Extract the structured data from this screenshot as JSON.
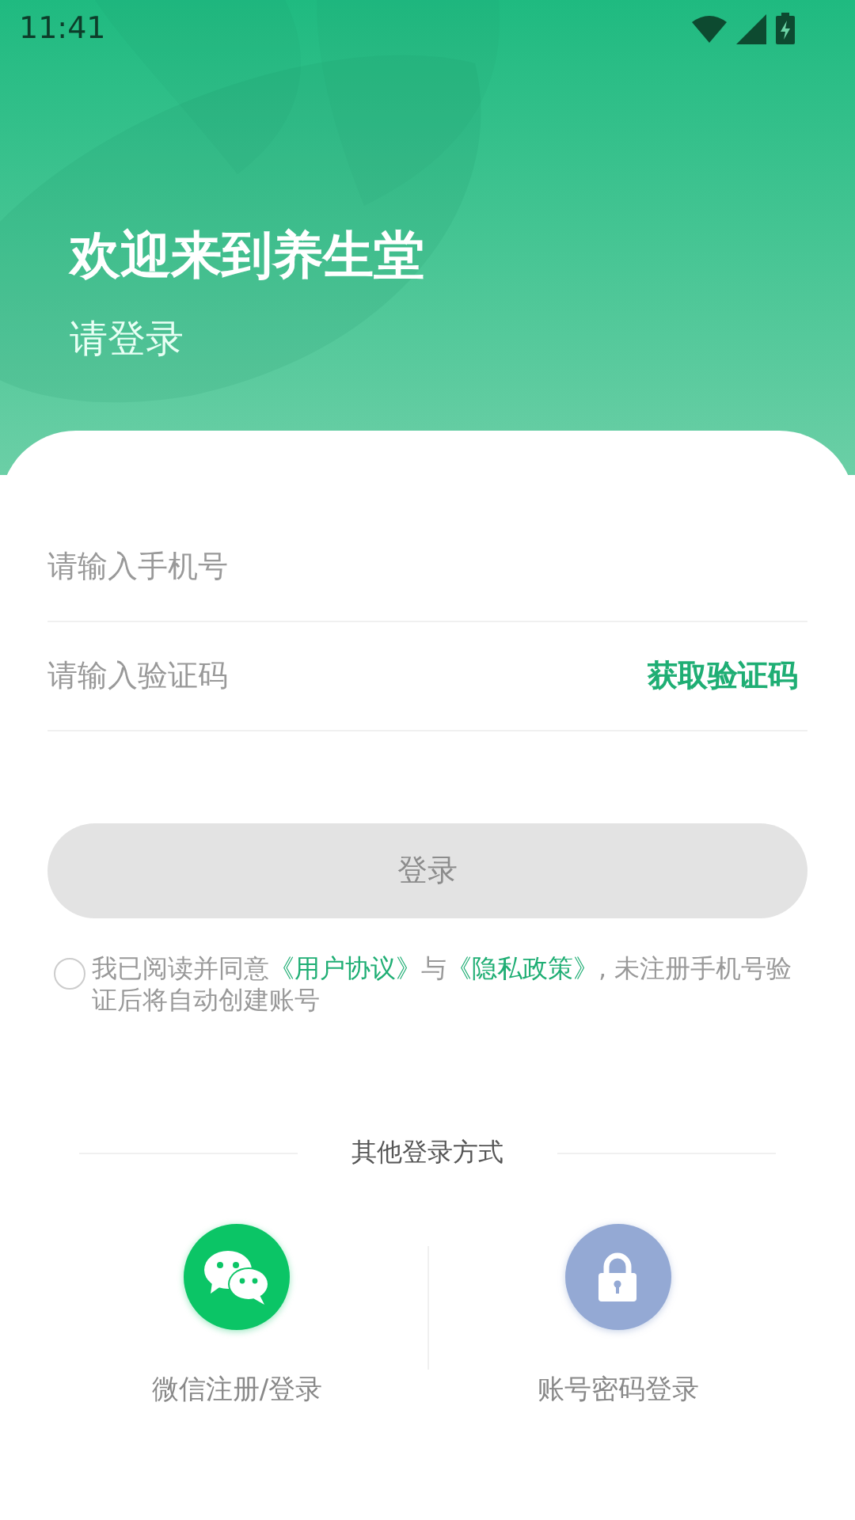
{
  "status_bar": {
    "time": "11:41"
  },
  "header": {
    "title": "欢迎来到养生堂",
    "subtitle": "请登录"
  },
  "form": {
    "phone": {
      "placeholder": "请输入手机号"
    },
    "code": {
      "placeholder": "请输入验证码",
      "action": "获取验证码"
    },
    "login_button": {
      "label": "登录",
      "disabled": true
    }
  },
  "agreement": {
    "checked": false,
    "parts": [
      {
        "kind": "plain",
        "text": "我已阅读并同意"
      },
      {
        "kind": "link",
        "text": "《用户协议》"
      },
      {
        "kind": "plain",
        "text": "与"
      },
      {
        "kind": "link",
        "text": "《隐私政策》"
      },
      {
        "kind": "plain",
        "text": ", 未注册手机号验证后将自动创建账号"
      }
    ]
  },
  "other_login": {
    "title": "其他登录方式",
    "options": [
      {
        "kind": "wechat",
        "label": "微信注册/登录"
      },
      {
        "kind": "password",
        "label": "账号密码登录"
      }
    ]
  }
}
